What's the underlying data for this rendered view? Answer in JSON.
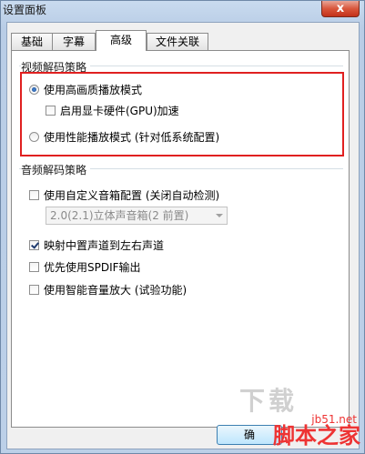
{
  "window": {
    "title": "设置面板",
    "close_label": "x"
  },
  "tabs": [
    {
      "label": "基础"
    },
    {
      "label": "字幕"
    },
    {
      "label": "高级",
      "active": true
    },
    {
      "label": "文件关联"
    }
  ],
  "video_group": {
    "title": "视频解码策略",
    "options": [
      {
        "type": "radio",
        "label": "使用高画质播放模式",
        "checked": true
      },
      {
        "type": "checkbox",
        "label": "启用显卡硬件(GPU)加速",
        "checked": false
      },
      {
        "type": "radio",
        "label": "使用性能播放模式 (针对低系统配置)",
        "checked": false
      }
    ],
    "highlight_color": "#e02020"
  },
  "audio_group": {
    "title": "音频解码策略",
    "custom_speaker": {
      "label": "使用自定义音箱配置 (关闭自动检测)",
      "checked": false
    },
    "speaker_select": {
      "value": "2.0(2.1)立体声音箱(2 前置)",
      "disabled": true
    },
    "map_center": {
      "label": "映射中置声道到左右声道",
      "checked": true
    },
    "prefer_spdif": {
      "label": "优先使用SPDIF输出",
      "checked": false
    },
    "smart_volume": {
      "label": "使用智能音量放大 (试验功能)",
      "checked": false
    }
  },
  "footer": {
    "ok_label": "确"
  },
  "watermark": {
    "site": "jb51.net",
    "brand": "脚本之家",
    "overlay": "下载"
  }
}
